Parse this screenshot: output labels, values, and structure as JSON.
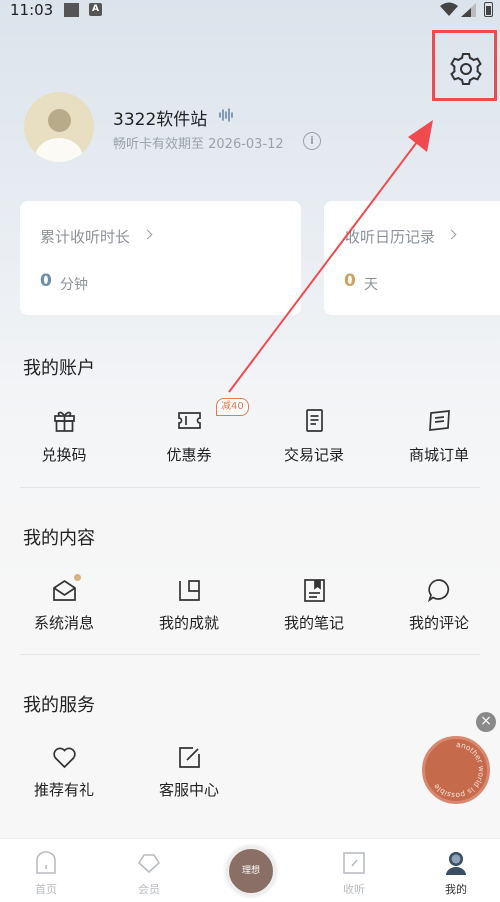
{
  "status_bar": {
    "time": "11:03",
    "notif_letter": "A"
  },
  "profile": {
    "username": "3322软件站",
    "expiry_text": "畅听卡有效期至 2026-03-12",
    "info_glyph": "i"
  },
  "stats": [
    {
      "title": "累计收听时长",
      "value": "0",
      "unit": "分钟",
      "value_color": "#6e8ea8"
    },
    {
      "title": "收听日历记录",
      "value": "0",
      "unit": "天",
      "value_color": "#c9a663"
    }
  ],
  "sections": {
    "account": {
      "title": "我的账户",
      "items": [
        {
          "label": "兑换码",
          "icon": "gift-icon"
        },
        {
          "label": "优惠券",
          "icon": "coupon-icon"
        },
        {
          "label": "交易记录",
          "icon": "receipt-icon"
        },
        {
          "label": "商城订单",
          "icon": "order-list-icon"
        }
      ],
      "discount_badge": "减40"
    },
    "content": {
      "title": "我的内容",
      "items": [
        {
          "label": "系统消息",
          "icon": "mail-icon"
        },
        {
          "label": "我的成就",
          "icon": "achievement-icon"
        },
        {
          "label": "我的笔记",
          "icon": "notes-icon"
        },
        {
          "label": "我的评论",
          "icon": "comment-icon"
        }
      ]
    },
    "service": {
      "title": "我的服务",
      "items": [
        {
          "label": "推荐有礼",
          "icon": "heart-icon"
        },
        {
          "label": "客服中心",
          "icon": "edit-icon"
        }
      ]
    }
  },
  "floating": {
    "close_glyph": "×",
    "badge_text": "another world is possible"
  },
  "tabbar": {
    "tabs": [
      {
        "label": "首页",
        "icon": "home-icon"
      },
      {
        "label": "会员",
        "icon": "diamond-icon"
      },
      {
        "label": "收听",
        "icon": "listen-icon"
      },
      {
        "label": "我的",
        "icon": "profile-icon",
        "active": true
      }
    ],
    "center_label": "理想"
  },
  "colors": {
    "highlight": "#f04a50",
    "accent_orange": "#e67a50",
    "badge_bg": "#c66a4c"
  }
}
